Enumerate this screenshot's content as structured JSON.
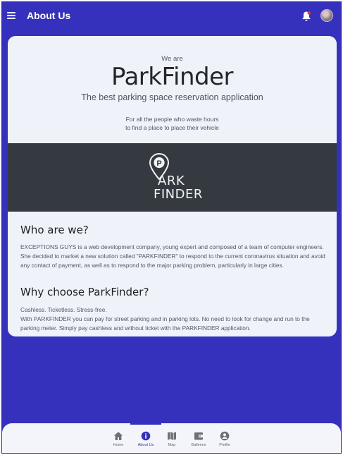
{
  "header": {
    "title": "About Us",
    "menu_icon": "hamburger-menu-icon",
    "notification_icon": "bell-icon",
    "avatar_icon": "user-avatar"
  },
  "hero": {
    "eyebrow": "We are",
    "brand": "ParkFinder",
    "tagline": "The best parking space reservation application",
    "intro_line1": "For all the people who waste hours",
    "intro_line2": "to find a place to place their vehicle"
  },
  "logo": {
    "line1": "ARK",
    "line2": "FINDER",
    "pin_letter": "P",
    "icon": "location-pin-icon"
  },
  "sections": {
    "who": {
      "heading": "Who are we?",
      "text1": "EXCEPTIONS GUYS is a web development company, young expert and composed of a team of computer engineers.",
      "text2": "She decided to market a new solution called \"PARKFINDER\" to respond to the current coronavirus situation and avoid any contact of payment, as well as to respond to the major parking problem, particularly in large cities."
    },
    "why": {
      "heading": "Why choose ParkFinder?",
      "text1": "Cashless. Ticketless. Stress-free.",
      "text2": "With PARKFINDER you can pay for street parking and in parking lots. No need to look for change and run to the parking meter. Simply pay cashless and without ticket with the PARKFINDER application."
    }
  },
  "bottom_nav": {
    "items": [
      {
        "label": "Home",
        "icon": "home-icon"
      },
      {
        "label": "About Us",
        "icon": "info-icon",
        "active": true
      },
      {
        "label": "Map",
        "icon": "map-icon"
      },
      {
        "label": "Ballence",
        "icon": "wallet-icon"
      },
      {
        "label": "Profile",
        "icon": "profile-icon"
      }
    ]
  },
  "colors": {
    "background": "#3531bd",
    "card": "#eff2f8",
    "banner": "#343a40",
    "active_nav": "#3531bd"
  }
}
